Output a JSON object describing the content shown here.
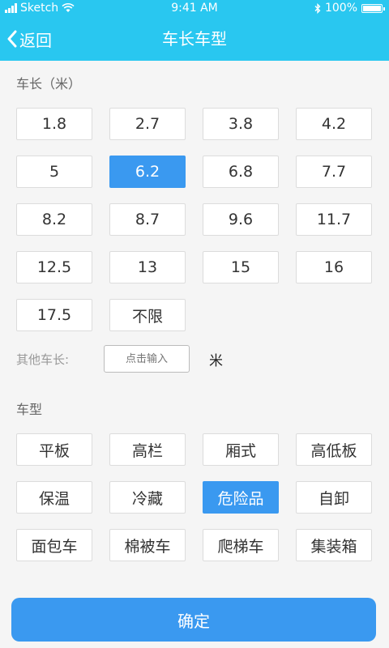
{
  "status_bar": {
    "carrier": "Sketch",
    "time": "9:41 AM",
    "battery": "100%"
  },
  "nav": {
    "back_label": "返回",
    "title": "车长车型"
  },
  "length_section": {
    "label": "车长（米）",
    "options": [
      "1.8",
      "2.7",
      "3.8",
      "4.2",
      "5",
      "6.2",
      "6.8",
      "7.7",
      "8.2",
      "8.7",
      "9.6",
      "11.7",
      "12.5",
      "13",
      "15",
      "16",
      "17.5",
      "不限"
    ],
    "selected": "6.2"
  },
  "other_length": {
    "label": "其他车长:",
    "placeholder": "点击输入",
    "unit": "米"
  },
  "type_section": {
    "label": "车型",
    "options": [
      "平板",
      "高栏",
      "厢式",
      "高低板",
      "保温",
      "冷藏",
      "危险品",
      "自卸",
      "面包车",
      "棉被车",
      "爬梯车",
      "集装箱"
    ],
    "selected": "危险品"
  },
  "confirm_label": "确定",
  "colors": {
    "header": "#29c7f0",
    "accent": "#3a99f0"
  }
}
